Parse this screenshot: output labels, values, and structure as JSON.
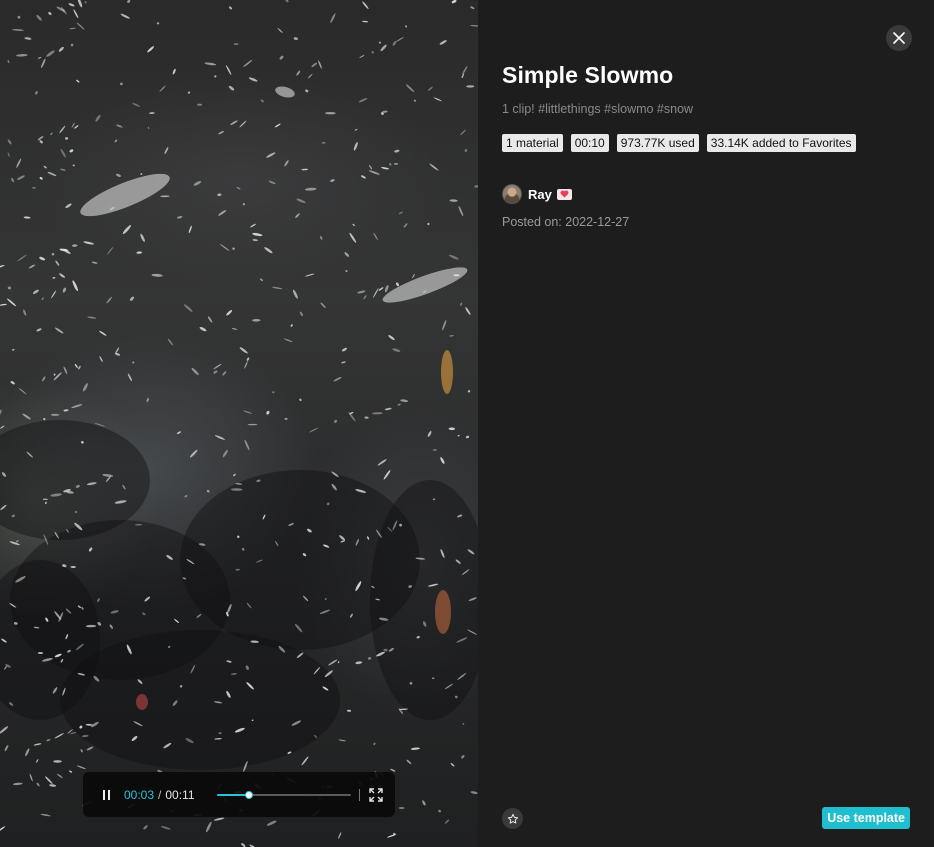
{
  "template": {
    "title": "Simple Slowmo",
    "description": "1 clip! #littlethings #slowmo #snow",
    "tags": [
      "1 material",
      "00:10",
      "973.77K used",
      "33.14K added to Favorites"
    ],
    "author_name": "Ray",
    "posted": "Posted on: 2022-12-27",
    "use_button_label": "Use template"
  },
  "player": {
    "current_time": "00:03",
    "separator": "/",
    "total_time": "00:11",
    "progress": 0.24
  },
  "colors": {
    "accent": "#1fbfd0",
    "panel_bg": "#1d1d1d",
    "time_highlight": "#28c4d9"
  },
  "icons": {
    "close": "close-icon",
    "pause": "pause-icon",
    "fullscreen": "fullscreen-icon",
    "favorite": "star-icon",
    "author_badge": "heart-icon"
  }
}
